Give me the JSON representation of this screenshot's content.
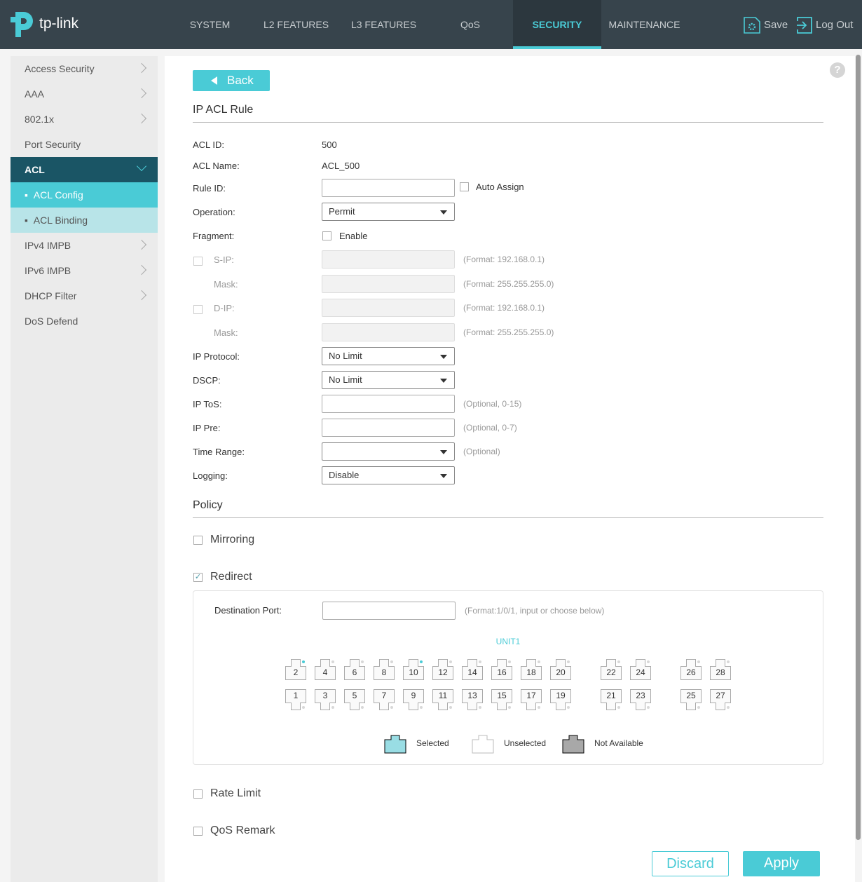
{
  "header": {
    "brand": "tp-link",
    "nav": [
      "SYSTEM",
      "L2 FEATURES",
      "L3 FEATURES",
      "QoS",
      "SECURITY",
      "MAINTENANCE"
    ],
    "active": "SECURITY",
    "save": "Save",
    "logout": "Log Out"
  },
  "sidebar": {
    "items": [
      "Access Security",
      "AAA",
      "802.1x",
      "Port Security",
      "ACL",
      "ACL Config",
      "ACL Binding",
      "IPv4 IMPB",
      "IPv6 IMPB",
      "DHCP Filter",
      "DoS Defend"
    ]
  },
  "main": {
    "back": "Back",
    "section_title": "IP ACL Rule",
    "acl_id_label": "ACL ID:",
    "acl_id": "500",
    "acl_name_label": "ACL Name:",
    "acl_name": "ACL_500",
    "rule_id_label": "Rule ID:",
    "rule_id": "",
    "auto_assign": "Auto Assign",
    "operation_label": "Operation:",
    "operation": "Permit",
    "fragment_label": "Fragment:",
    "fragment_enable": "Enable",
    "sip_label": "S-IP:",
    "sip_hint": "(Format: 192.168.0.1)",
    "smask_label": "Mask:",
    "smask_hint": "(Format: 255.255.255.0)",
    "dip_label": "D-IP:",
    "dip_hint": "(Format: 192.168.0.1)",
    "dmask_label": "Mask:",
    "dmask_hint": "(Format: 255.255.255.0)",
    "ipproto_label": "IP Protocol:",
    "ipproto": "No Limit",
    "dscp_label": "DSCP:",
    "dscp": "No Limit",
    "iptos_label": "IP ToS:",
    "iptos_hint": "(Optional, 0-15)",
    "ippre_label": "IP Pre:",
    "ippre_hint": "(Optional, 0-7)",
    "timerange_label": "Time Range:",
    "timerange": "",
    "timerange_hint": "(Optional)",
    "logging_label": "Logging:",
    "logging": "Disable"
  },
  "policy": {
    "title": "Policy",
    "mirroring": "Mirroring",
    "redirect": "Redirect",
    "redirect_checked": true,
    "dest_label": "Destination Port:",
    "dest_value": "",
    "dest_hint": "(Format:1/0/1, input or choose below)",
    "unit": "UNIT1",
    "top_ports": [
      "2",
      "4",
      "6",
      "8",
      "10",
      "12",
      "14",
      "16",
      "18",
      "20",
      "22",
      "24",
      "26",
      "28"
    ],
    "bottom_ports": [
      "1",
      "3",
      "5",
      "7",
      "9",
      "11",
      "13",
      "15",
      "17",
      "19",
      "21",
      "23",
      "25",
      "27"
    ],
    "link_up_ports": [
      "2",
      "10"
    ],
    "legend": {
      "selected": "Selected",
      "unselected": "Unselected",
      "not_available": "Not Available"
    },
    "rate_limit": "Rate Limit",
    "qos_remark": "QoS Remark"
  },
  "buttons": {
    "discard": "Discard",
    "apply": "Apply"
  },
  "colors": {
    "accent": "#4acbd6",
    "header": "#37444c",
    "acl_active": "#1a5565"
  }
}
